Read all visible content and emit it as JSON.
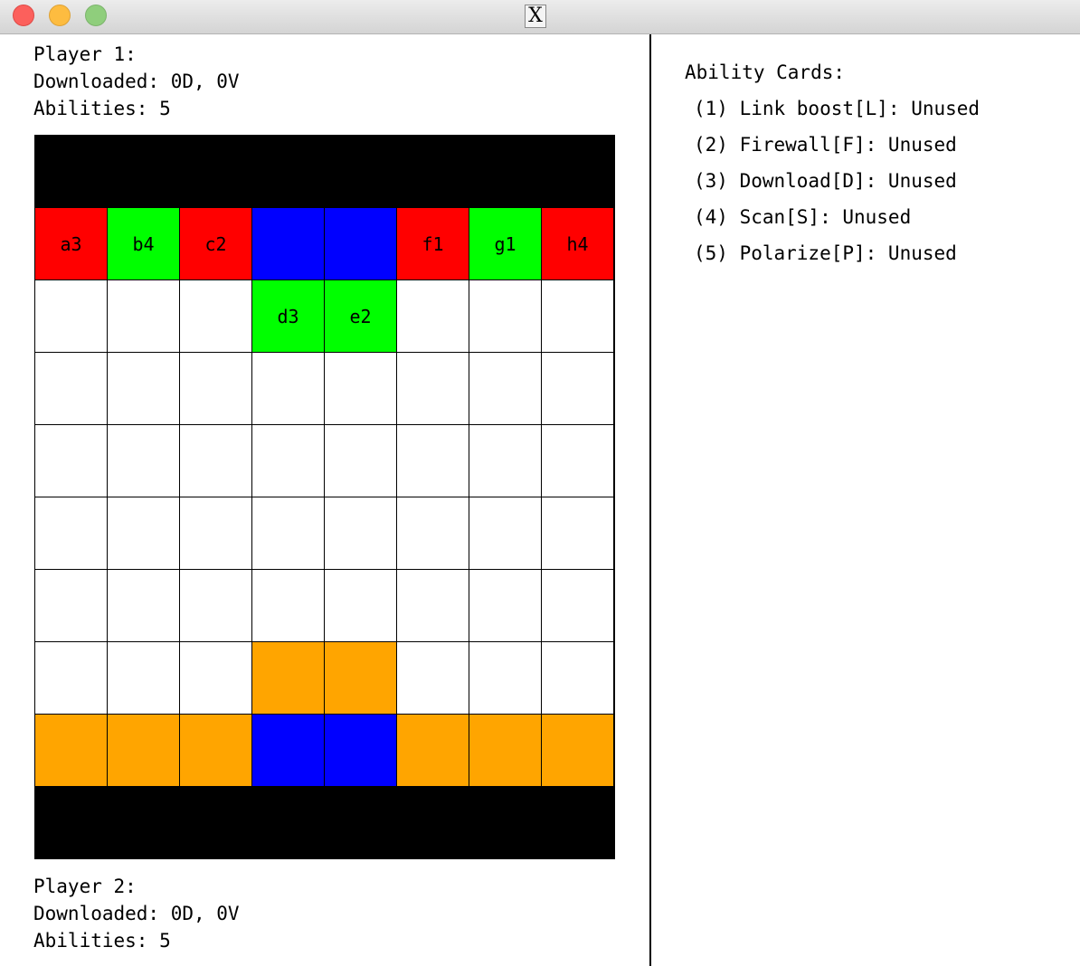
{
  "window": {
    "title_icon": "x11-icon"
  },
  "player1": {
    "name": "Player 1:",
    "downloaded": "Downloaded: 0D, 0V",
    "abilities": "Abilities: 5"
  },
  "player2": {
    "name": "Player 2:",
    "downloaded": "Downloaded: 0D, 0V",
    "abilities": "Abilities: 5"
  },
  "ability_cards": {
    "heading": "Ability Cards:",
    "items": [
      "(1) Link boost[L]: Unused",
      "(2) Firewall[F]: Unused",
      "(3) Download[D]: Unused",
      "(4) Scan[S]: Unused",
      "(5) Polarize[P]: Unused"
    ]
  },
  "colors": {
    "red": "#ff0000",
    "green": "#00ff00",
    "blue": "#0000ff",
    "orange": "#ffa500",
    "empty": "#ffffff",
    "edge": "#000000"
  },
  "board": {
    "rows": [
      [
        {
          "c": "red",
          "t": "a3"
        },
        {
          "c": "green",
          "t": "b4"
        },
        {
          "c": "red",
          "t": "c2"
        },
        {
          "c": "blue",
          "t": ""
        },
        {
          "c": "blue",
          "t": ""
        },
        {
          "c": "red",
          "t": "f1"
        },
        {
          "c": "green",
          "t": "g1"
        },
        {
          "c": "red",
          "t": "h4"
        }
      ],
      [
        {
          "c": "empty",
          "t": ""
        },
        {
          "c": "empty",
          "t": ""
        },
        {
          "c": "empty",
          "t": ""
        },
        {
          "c": "green",
          "t": "d3"
        },
        {
          "c": "green",
          "t": "e2"
        },
        {
          "c": "empty",
          "t": ""
        },
        {
          "c": "empty",
          "t": ""
        },
        {
          "c": "empty",
          "t": ""
        }
      ],
      [
        {
          "c": "empty",
          "t": ""
        },
        {
          "c": "empty",
          "t": ""
        },
        {
          "c": "empty",
          "t": ""
        },
        {
          "c": "empty",
          "t": ""
        },
        {
          "c": "empty",
          "t": ""
        },
        {
          "c": "empty",
          "t": ""
        },
        {
          "c": "empty",
          "t": ""
        },
        {
          "c": "empty",
          "t": ""
        }
      ],
      [
        {
          "c": "empty",
          "t": ""
        },
        {
          "c": "empty",
          "t": ""
        },
        {
          "c": "empty",
          "t": ""
        },
        {
          "c": "empty",
          "t": ""
        },
        {
          "c": "empty",
          "t": ""
        },
        {
          "c": "empty",
          "t": ""
        },
        {
          "c": "empty",
          "t": ""
        },
        {
          "c": "empty",
          "t": ""
        }
      ],
      [
        {
          "c": "empty",
          "t": ""
        },
        {
          "c": "empty",
          "t": ""
        },
        {
          "c": "empty",
          "t": ""
        },
        {
          "c": "empty",
          "t": ""
        },
        {
          "c": "empty",
          "t": ""
        },
        {
          "c": "empty",
          "t": ""
        },
        {
          "c": "empty",
          "t": ""
        },
        {
          "c": "empty",
          "t": ""
        }
      ],
      [
        {
          "c": "empty",
          "t": ""
        },
        {
          "c": "empty",
          "t": ""
        },
        {
          "c": "empty",
          "t": ""
        },
        {
          "c": "empty",
          "t": ""
        },
        {
          "c": "empty",
          "t": ""
        },
        {
          "c": "empty",
          "t": ""
        },
        {
          "c": "empty",
          "t": ""
        },
        {
          "c": "empty",
          "t": ""
        }
      ],
      [
        {
          "c": "empty",
          "t": ""
        },
        {
          "c": "empty",
          "t": ""
        },
        {
          "c": "empty",
          "t": ""
        },
        {
          "c": "orange",
          "t": ""
        },
        {
          "c": "orange",
          "t": ""
        },
        {
          "c": "empty",
          "t": ""
        },
        {
          "c": "empty",
          "t": ""
        },
        {
          "c": "empty",
          "t": ""
        }
      ],
      [
        {
          "c": "orange",
          "t": ""
        },
        {
          "c": "orange",
          "t": ""
        },
        {
          "c": "orange",
          "t": ""
        },
        {
          "c": "blue",
          "t": ""
        },
        {
          "c": "blue",
          "t": ""
        },
        {
          "c": "orange",
          "t": ""
        },
        {
          "c": "orange",
          "t": ""
        },
        {
          "c": "orange",
          "t": ""
        }
      ]
    ]
  }
}
